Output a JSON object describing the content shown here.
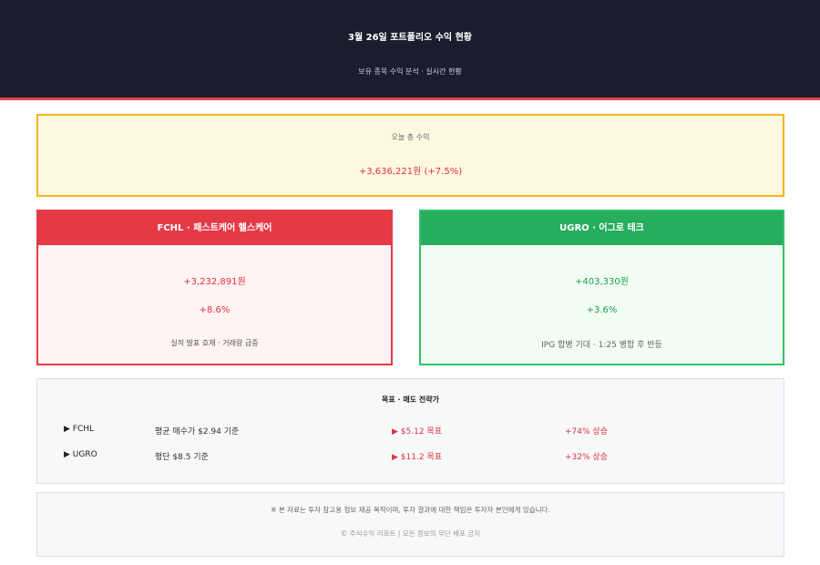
{
  "header": {
    "title": "3월 26일 포트폴리오 수익 현황",
    "subtitle": "보유 종목 수익 분석 · 실시간 현황"
  },
  "total": {
    "label": "오늘 총 수익",
    "value": "+3,636,221원 (+7.5%)"
  },
  "cards": [
    {
      "header": "FCHL · 패스트케어 헬스케어",
      "amount": "+3,232,891원",
      "percent": "+8.6%",
      "note": "실적 발표 호재 · 거래량 급증",
      "accent": "#e63946"
    },
    {
      "header": "UGRO · 어그로 테크",
      "amount": "+403,330원",
      "percent": "+3.6%",
      "note": "IPG 합병 기대 · 1:25 병합 후 반등",
      "accent": "#26ad5e"
    }
  ],
  "targets": {
    "title": "목표 · 매도 전략가",
    "rows": [
      {
        "symbol": "▶ FCHL",
        "avg": "평균 매수가 $2.94 기준",
        "target": "▶ $5.12 목표",
        "gain": "+74% 상승"
      },
      {
        "symbol": "▶ UGRO",
        "avg": "평단 $8.5 기준",
        "target": "▶ $11.2 목표",
        "gain": "+32% 상승"
      }
    ]
  },
  "footer": {
    "disclaimer": "※ 본 자료는 투자 참고용 정보 제공 목적이며, 투자 결과에 대한 책임은 투자자 본인에게 있습니다.",
    "copyright": "© 주식수익 리포트 | 모든 정보의 무단 배포 금지"
  }
}
